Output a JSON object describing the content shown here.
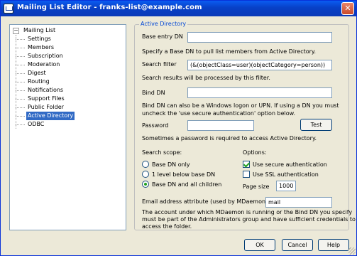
{
  "window": {
    "title": "Mailing List Editor - franks-list@example.com",
    "close_glyph": "✕"
  },
  "tree": {
    "root": "Mailing List",
    "toggle": "−",
    "items": [
      {
        "label": "Settings"
      },
      {
        "label": "Members"
      },
      {
        "label": "Subscription"
      },
      {
        "label": "Moderation"
      },
      {
        "label": "Digest"
      },
      {
        "label": "Routing"
      },
      {
        "label": "Notifications"
      },
      {
        "label": "Support Files"
      },
      {
        "label": "Public Folder"
      },
      {
        "label": "Active Directory",
        "selected": true
      },
      {
        "label": "ODBC"
      }
    ]
  },
  "ad": {
    "group_title": "Active Directory",
    "base_dn_label": "Base entry DN",
    "base_dn_value": "",
    "base_dn_help": "Specify a Base DN to pull list members from Active Directory.",
    "search_filter_label": "Search filter",
    "search_filter_value": "(&(objectClass=user)(objectCategory=person))",
    "search_filter_help": "Search results will be processed by this filter.",
    "bind_dn_label": "Bind DN",
    "bind_dn_value": "",
    "bind_dn_help_1": "Bind DN can also be a Windows logon or UPN.  If using a DN you must",
    "bind_dn_help_2": "uncheck the 'use secure authentication' option below.",
    "password_label": "Password",
    "password_value": "",
    "test_button": "Test",
    "password_help": "Sometimes a password is required to access Active Directory.",
    "scope_label": "Search scope:",
    "scope_options": [
      {
        "label": "Base DN only",
        "checked": false
      },
      {
        "label": "1 level below base DN",
        "checked": false
      },
      {
        "label": "Base DN and all children",
        "checked": true
      }
    ],
    "options_label": "Options:",
    "use_secure_auth": {
      "label": "Use secure authentication",
      "checked": true
    },
    "use_ssl_auth": {
      "label": "Use SSL authentication",
      "checked": false
    },
    "page_size_label": "Page size",
    "page_size_value": "1000",
    "email_attr_label": "Email address attribute (used by MDaemon lists)",
    "email_attr_value": "mail",
    "note_1": "The account under which MDaemon is running or the Bind DN you specify",
    "note_2": "must be part of the Administrators group and have sufficient credentials to",
    "note_3": "access the folder."
  },
  "buttons": {
    "ok": "OK",
    "cancel": "Cancel",
    "help": "Help"
  }
}
